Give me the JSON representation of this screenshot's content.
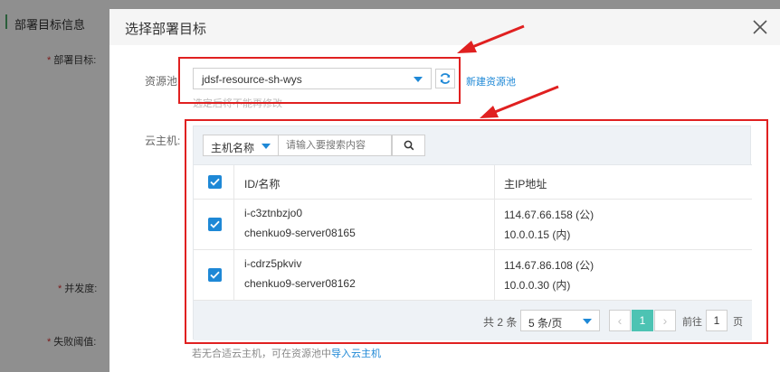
{
  "background": {
    "section_title": "部署目标信息",
    "labels": [
      {
        "star": "*",
        "text": "部署目标:"
      },
      {
        "star": "*",
        "text": "并发度:"
      },
      {
        "star": "*",
        "text": "失败阈值:"
      }
    ]
  },
  "modal": {
    "title": "选择部署目标",
    "close_icon": "close-icon"
  },
  "resource_pool": {
    "label": "资源池:",
    "selected": "jdsf-resource-sh-wys",
    "new_pool_link": "新建资源池",
    "hint": "选定后将不能再修改"
  },
  "vm": {
    "label": "云主机:",
    "filter_field": "主机名称",
    "search_placeholder": "请输入要搜索内容",
    "columns": {
      "id_name": "ID/名称",
      "main_ip": "主IP地址"
    },
    "rows": [
      {
        "id": "i-c3ztnbzjo0",
        "name": "chenkuo9-server08165",
        "public_ip": "114.67.66.158 (公)",
        "private_ip": "10.0.0.15 (内)",
        "checked": true
      },
      {
        "id": "i-cdrz5pkviv",
        "name": "chenkuo9-server08162",
        "public_ip": "114.67.86.108 (公)",
        "private_ip": "10.0.0.30 (内)",
        "checked": true
      }
    ]
  },
  "pager": {
    "total": "共 2 条",
    "page_size": "5 条/页",
    "current_page": "1",
    "goto_label": "前往",
    "goto_value": "1",
    "goto_unit": "页"
  },
  "footer": {
    "hint_prefix": "若无合适云主机，可在资源池中",
    "import_link": "导入云主机"
  },
  "colors": {
    "accent": "#1e88d6",
    "annotation_red": "#e02020",
    "pager_active": "#4dc3b3"
  }
}
